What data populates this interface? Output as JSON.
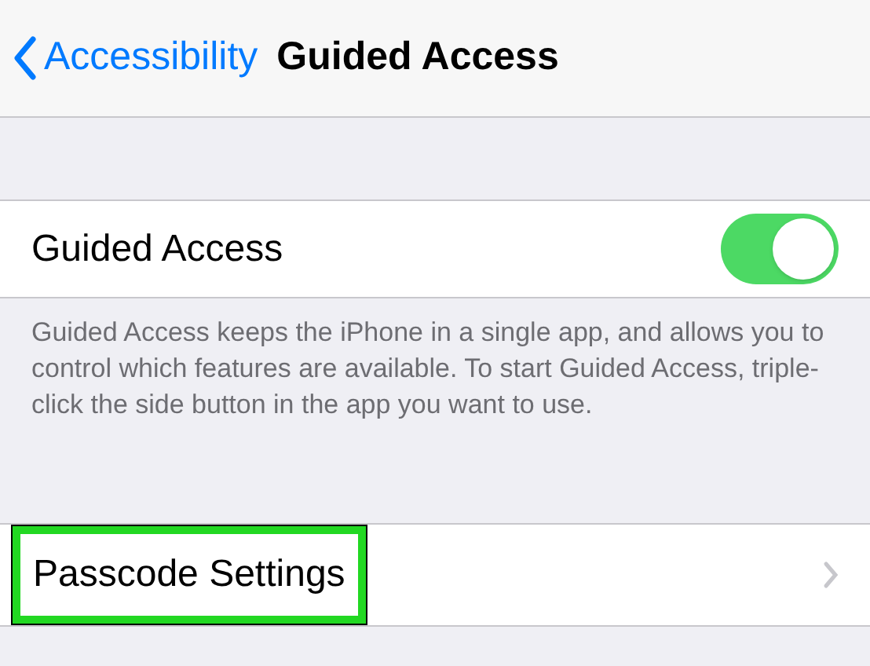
{
  "nav_bar": {
    "back_label": "Accessibility",
    "title": "Guided Access"
  },
  "toggle_row": {
    "label": "Guided Access",
    "on": true
  },
  "footer": "Guided Access keeps the iPhone in a single app, and allows you to control which features are available. To start Guided Access, triple-click the side button in the app you want to use.",
  "link_row": {
    "label": "Passcode Settings",
    "highlighted": true
  }
}
